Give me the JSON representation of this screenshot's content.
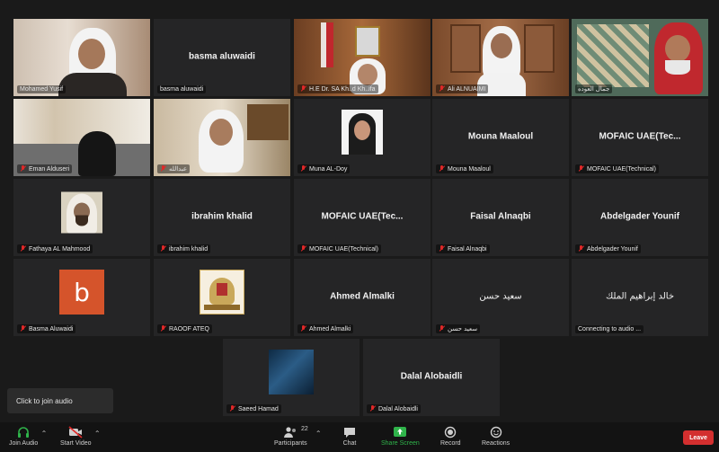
{
  "tiles": [
    {
      "name": "Mohamed Yusif",
      "center": ""
    },
    {
      "name": "basma aluwaidi",
      "center": "basma aluwaidi"
    },
    {
      "name": "H.E Dr. SA Kh..d Kh..ifa",
      "center": ""
    },
    {
      "name": "Ali ALNUAIMI",
      "center": ""
    },
    {
      "name": "جمال العوده",
      "center": ""
    },
    {
      "name": "Eman Alduseri",
      "center": ""
    },
    {
      "name": "عبدالله",
      "center": ""
    },
    {
      "name": "Muna AL-Doy",
      "center": ""
    },
    {
      "name": "Mouna Maaloul",
      "center": "Mouna Maaloul"
    },
    {
      "name": "MOFAIC UAE(Technical)",
      "center": "MOFAIC UAE(Tec..."
    },
    {
      "name": "Fathaya AL Mahmood",
      "center": ""
    },
    {
      "name": "ibrahim khalid",
      "center": "ibrahim khalid"
    },
    {
      "name": "MOFAIC UAE(Technical)",
      "center": "MOFAIC UAE(Tec..."
    },
    {
      "name": "Faisal Alnaqbi",
      "center": "Faisal Alnaqbi"
    },
    {
      "name": "Abdelgader Younif",
      "center": "Abdelgader Younif"
    },
    {
      "name": "Basma Aluwaidi",
      "center": ""
    },
    {
      "name": "RAOOF ATEQ",
      "center": ""
    },
    {
      "name": "Ahmed Almalki",
      "center": "Ahmed Almalki"
    },
    {
      "name": "سعيد حسن",
      "center": "سعيد حسن"
    },
    {
      "name": "Connecting to audio ...",
      "center": "خالد إبراهيم الملك"
    },
    {
      "name": "Saeed Hamad",
      "center": ""
    },
    {
      "name": "Dalal Alobaidli",
      "center": "Dalal Alobaidli"
    }
  ],
  "avatar_letter": "b",
  "join_audio_prompt": "Click to join audio",
  "toolbar": {
    "join_audio": "Join Audio",
    "start_video": "Start Video",
    "participants": "Participants",
    "participants_count": "22",
    "chat": "Chat",
    "share_screen": "Share Screen",
    "record": "Record",
    "reactions": "Reactions",
    "leave": "Leave"
  },
  "colors": {
    "accent_green": "#2fb34a",
    "leave_red": "#d32f2f",
    "active_speaker": "#f5d547",
    "mic_off": "#e02828"
  }
}
